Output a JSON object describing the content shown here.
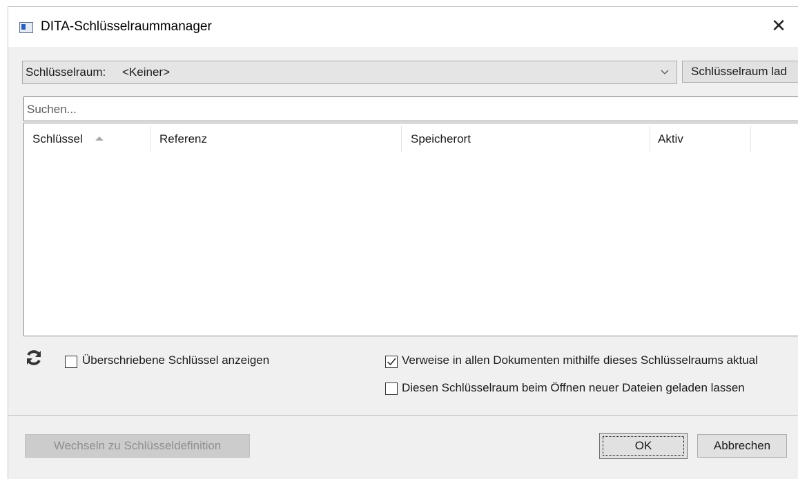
{
  "window": {
    "title": "DITA-Schlüsselraummanager",
    "close_glyph": "✕"
  },
  "keyspace": {
    "label": "Schlüsselraum:",
    "selected_value": "<Keiner>",
    "load_button": "Schlüsselraum lad"
  },
  "search": {
    "placeholder": "Suchen..."
  },
  "table": {
    "columns": [
      "Schlüssel",
      "Referenz",
      "Speicherort",
      "Aktiv"
    ],
    "sorted_column": "Schlüssel",
    "sort_direction": "ascending",
    "rows": []
  },
  "options": {
    "show_overridden_label": "Überschriebene Schlüssel anzeigen",
    "show_overridden_checked": false,
    "update_refs_label": "Verweise in allen Dokumenten mithilfe dieses Schlüsselraums aktual",
    "update_refs_checked": true,
    "keep_loaded_label": "Diesen Schlüsselraum beim Öffnen neuer Dateien geladen lassen",
    "keep_loaded_checked": false
  },
  "footer": {
    "switch_button": "Wechseln zu Schlüsseldefinition",
    "ok_button": "OK",
    "cancel_button": "Abbrechen"
  },
  "icons": {
    "app": "app-window-icon",
    "refresh": "refresh-icon",
    "dropdown": "chevron-down-icon",
    "sort": "sort-ascending-icon",
    "close": "close-icon"
  }
}
